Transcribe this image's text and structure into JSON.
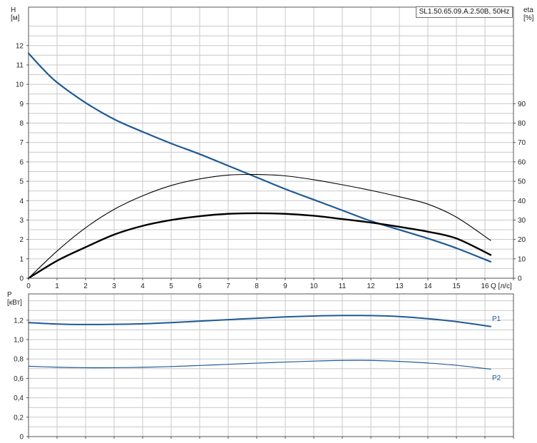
{
  "chart_data": [
    {
      "type": "line",
      "title": "SL1.50.65.09.A.2.50B, 50Hz",
      "xlabel": "Q [л/с]",
      "ylabel": "H [м]",
      "ylabel_right": "eta [%]",
      "xlim": [
        0,
        17
      ],
      "ylim": [
        0,
        13
      ],
      "ylim_right": [
        0,
        130
      ],
      "xticks": [
        "0",
        "1",
        "2",
        "3",
        "4",
        "5",
        "6",
        "7",
        "8",
        "9",
        "10",
        "11",
        "12",
        "13",
        "14",
        "15",
        "16"
      ],
      "yticks": [
        "0",
        "1",
        "2",
        "3",
        "4",
        "5",
        "6",
        "7",
        "8",
        "9",
        "10",
        "11",
        "12"
      ],
      "yticks_right": [
        "0",
        "10",
        "20",
        "30",
        "40",
        "50",
        "60",
        "70",
        "80",
        "90"
      ],
      "grid": true,
      "series": [
        {
          "key": "H",
          "axis": "left",
          "color": "#1f5a96",
          "x": [
            0,
            0.5,
            1,
            2,
            3,
            4,
            5,
            6,
            7,
            8,
            9,
            10,
            11,
            12,
            13,
            14,
            15,
            16.2
          ],
          "values": [
            11.6,
            10.8,
            10.1,
            9.05,
            8.2,
            7.55,
            6.95,
            6.4,
            5.8,
            5.2,
            4.6,
            4.05,
            3.5,
            2.95,
            2.5,
            2.05,
            1.55,
            0.85
          ]
        },
        {
          "key": "eta_pump",
          "axis": "right",
          "color": "#000000",
          "x": [
            0,
            1,
            2,
            3,
            4,
            5,
            6,
            7,
            8,
            9,
            10,
            11,
            12,
            13,
            14,
            15,
            16.2
          ],
          "values": [
            0,
            9,
            16,
            22.5,
            27,
            30,
            32,
            33.2,
            33.5,
            33.2,
            32.2,
            30.5,
            28.7,
            26.5,
            24,
            20.5,
            12
          ]
        },
        {
          "key": "eta_total",
          "axis": "right",
          "color": "#000000",
          "x": [
            0,
            1,
            2,
            3,
            4,
            5,
            6,
            7,
            8,
            9,
            10,
            11,
            12,
            13,
            14,
            15,
            16.2
          ],
          "values": [
            0,
            14,
            26,
            35.5,
            42.5,
            47.8,
            51.2,
            53.2,
            53.5,
            52.8,
            50.8,
            48.2,
            45.3,
            42,
            38.2,
            31.5,
            19.5
          ]
        }
      ]
    },
    {
      "type": "line",
      "ylabel": "P [кВт]",
      "xlim": [
        0,
        17
      ],
      "ylim": [
        0,
        1.4
      ],
      "yticks": [
        "0",
        "0,2",
        "0,4",
        "0,6",
        "0,8",
        "1,0",
        "1,2"
      ],
      "grid": true,
      "series": [
        {
          "name": "P1",
          "color": "#1f5a96",
          "x": [
            0,
            1,
            2,
            3,
            4,
            5,
            6,
            7,
            8,
            9,
            10,
            11,
            12,
            13,
            14,
            15,
            16.2
          ],
          "values": [
            1.175,
            1.16,
            1.155,
            1.157,
            1.163,
            1.175,
            1.19,
            1.205,
            1.22,
            1.233,
            1.243,
            1.248,
            1.247,
            1.237,
            1.215,
            1.185,
            1.135
          ]
        },
        {
          "name": "P2",
          "color": "#1f5a96",
          "x": [
            0,
            1,
            2,
            3,
            4,
            5,
            6,
            7,
            8,
            9,
            10,
            11,
            12,
            13,
            14,
            15,
            16.2
          ],
          "values": [
            0.725,
            0.715,
            0.71,
            0.71,
            0.714,
            0.722,
            0.733,
            0.745,
            0.757,
            0.768,
            0.778,
            0.785,
            0.785,
            0.775,
            0.758,
            0.735,
            0.695
          ]
        }
      ]
    }
  ]
}
